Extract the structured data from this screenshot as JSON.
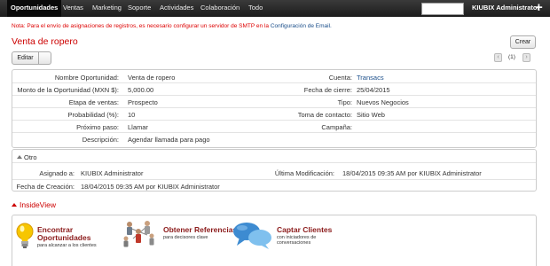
{
  "nav": {
    "items": [
      {
        "label": "Oportunidades",
        "active": true
      },
      {
        "label": "Ventas"
      },
      {
        "label": "Marketing"
      },
      {
        "label": "Soporte"
      },
      {
        "label": "Actividades"
      },
      {
        "label": "Colaboración"
      },
      {
        "label": "Todo"
      }
    ],
    "user": "KIUBIX Administrator",
    "plus_icon": "plus-icon"
  },
  "notice": {
    "text": "Nota: Para el envío de asignaciones de registros, es necesario configurar un servidor de SMTP en la ",
    "link": "Configuración de Email."
  },
  "page": {
    "title": "Venta de ropero",
    "create_label": "Crear",
    "edit_label": "Editar",
    "pager": {
      "count": "(1)"
    }
  },
  "detail": {
    "nombre_label": "Nombre Oportunidad:",
    "nombre": "Venta de ropero",
    "cuenta_label": "Cuenta:",
    "cuenta": "Transacs",
    "monto_label": "Monto de la Oportunidad (MXN $):",
    "monto": "5,000.00",
    "cierre_label": "Fecha de cierre:",
    "cierre": "25/04/2015",
    "etapa_label": "Etapa de ventas:",
    "etapa": "Prospecto",
    "tipo_label": "Tipo:",
    "tipo": "Nuevos Negocios",
    "prob_label": "Probabilidad (%):",
    "prob": "10",
    "toma_label": "Toma de contacto:",
    "toma": "Sitio Web",
    "proximo_label": "Próximo paso:",
    "proximo": "Llamar",
    "campana_label": "Campaña:",
    "campana": "",
    "desc_label": "Descripción:",
    "desc": "Agendar llamada para pago"
  },
  "otro": {
    "header": "Otro",
    "asignado_label": "Asignado a:",
    "asignado": "KIUBIX Administrator",
    "ultima_label": "Última Modificación:",
    "ultima": "18/04/2015 09:35 AM por KIUBIX Administrator",
    "creacion_label": "Fecha de Creación:",
    "creacion": "18/04/2015 09:35 AM por KIUBIX Administrator"
  },
  "insideview": {
    "title": "InsideView",
    "cards": [
      {
        "title1": "Encontrar",
        "title2": "Oportunidades",
        "sub1": "para alcanzar a los clientes",
        "sub2": "",
        "icon": "lightbulb-icon"
      },
      {
        "title1": "Obtener Referencias",
        "title2": "",
        "sub1": "para decisores clave",
        "sub2": "",
        "icon": "people-network-icon"
      },
      {
        "title1": "Captar Clientes",
        "title2": "",
        "sub1": "con iniciadores de",
        "sub2": "conversaciones",
        "icon": "chat-bubbles-icon"
      }
    ]
  }
}
